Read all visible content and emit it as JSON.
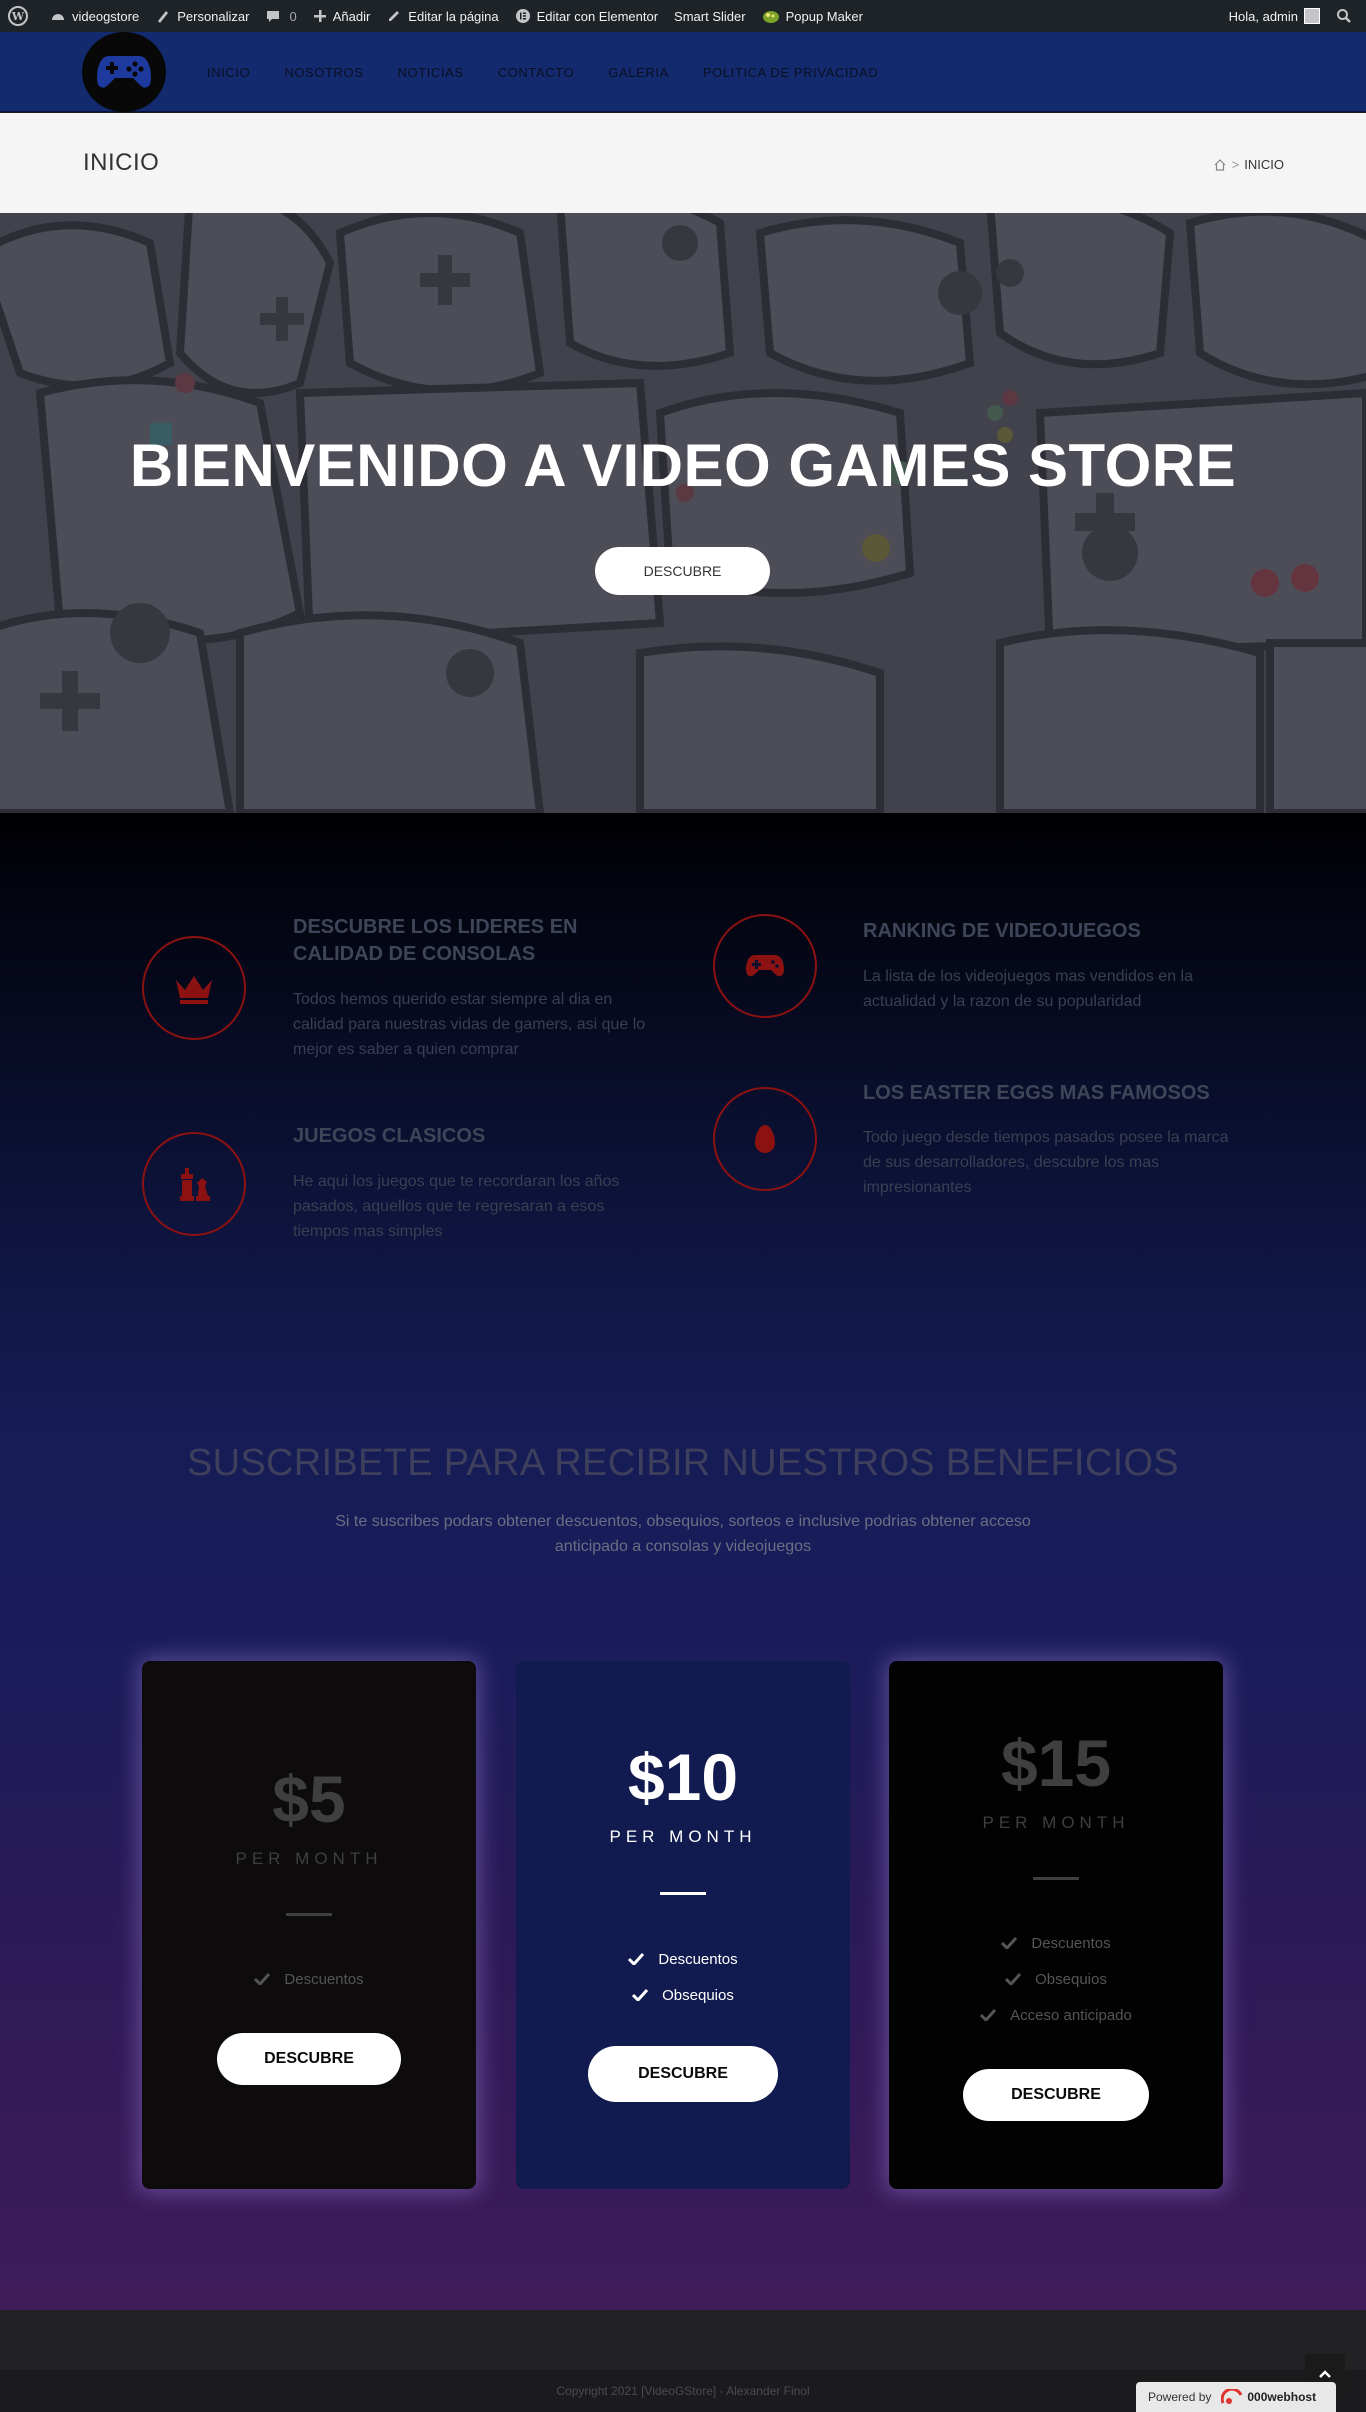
{
  "admin_bar": {
    "site_name": "videogstore",
    "customize": "Personalizar",
    "comments_count": "0",
    "add_new": "Añadir",
    "edit_page": "Editar la página",
    "edit_elementor": "Editar con Elementor",
    "smart_slider": "Smart Slider",
    "popup_maker": "Popup Maker",
    "greeting": "Hola, admin"
  },
  "nav": {
    "items": [
      "INICIO",
      "NOSOTROS",
      "NOTICIAS",
      "CONTACTO",
      "GALERIA",
      "POLITICA DE PRIVACIDAD"
    ]
  },
  "page_title": {
    "title": "INICIO",
    "breadcrumb_current": "INICIO",
    "breadcrumb_separator": ">"
  },
  "hero": {
    "heading": "BIENVENIDO A VIDEO GAMES STORE",
    "button_label": "DESCUBRE"
  },
  "features": [
    {
      "title": "DESCUBRE LOS LIDERES EN CALIDAD DE CONSOLAS",
      "text": "Todos hemos querido estar siempre al dia en calidad para nuestras vidas de gamers, asi que lo mejor es saber a quien comprar",
      "icon": "crown-icon"
    },
    {
      "title": "RANKING DE VIDEOJUEGOS",
      "text": "La lista de los videojuegos mas vendidos en la actualidad y la razon de su popularidad",
      "icon": "gamepad-icon"
    },
    {
      "title": "JUEGOS CLASICOS",
      "text": "He aqui los juegos que te recordaran los años pasados, aquellos que te regresaran a esos tiempos mas simples",
      "icon": "chess-icon"
    },
    {
      "title": "LOS EASTER EGGS MAS FAMOSOS",
      "text": "Todo juego desde tiempos pasados posee la marca de sus desarrolladores, descubre los mas impresionantes",
      "icon": "egg-icon"
    }
  ],
  "subscribe": {
    "title": "SUSCRIBETE PARA RECIBIR NUESTROS BENEFICIOS",
    "description": "Si te suscribes podars obtener descuentos, obsequios, sorteos e inclusive podrias obtener acceso anticipado a consolas y videojuegos"
  },
  "pricing": [
    {
      "price": "$5",
      "period": "PER MONTH",
      "features": [
        "Descuentos"
      ],
      "button": "DESCUBRE"
    },
    {
      "price": "$10",
      "period": "PER MONTH",
      "features": [
        "Descuentos",
        "Obsequios"
      ],
      "button": "DESCUBRE"
    },
    {
      "price": "$15",
      "period": "PER MONTH",
      "features": [
        "Descuentos",
        "Obsequios",
        "Acceso anticipado"
      ],
      "button": "DESCUBRE"
    }
  ],
  "footer": {
    "copyright": "Copyright 2021 [VideoGStore] - Alexander Finol",
    "powered_by": "Powered by",
    "host_brand": "000webhost"
  },
  "colors": {
    "header_blue": "#142a6e",
    "accent_red": "#8c1212",
    "card_mid": "#121b4f"
  }
}
